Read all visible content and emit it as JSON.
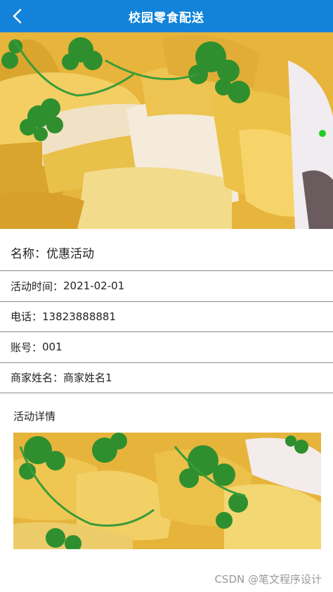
{
  "header": {
    "title": "校园零食配送",
    "back_icon": "chevron-left-icon"
  },
  "activity": {
    "name_label": "名称：",
    "name_value": "优惠活动",
    "fields": [
      {
        "label": "活动时间：",
        "value": "2021-02-01"
      },
      {
        "label": "电话：",
        "value": "13823888881"
      },
      {
        "label": "账号：",
        "value": "001"
      },
      {
        "label": "商家姓名：",
        "value": "商家姓名1"
      }
    ]
  },
  "details": {
    "label": "活动详情"
  },
  "watermark": "CSDN @笔文程序设计",
  "colors": {
    "header_bg": "#1283d9",
    "divider": "#8a8a8a",
    "indicator": "#22cc22"
  }
}
